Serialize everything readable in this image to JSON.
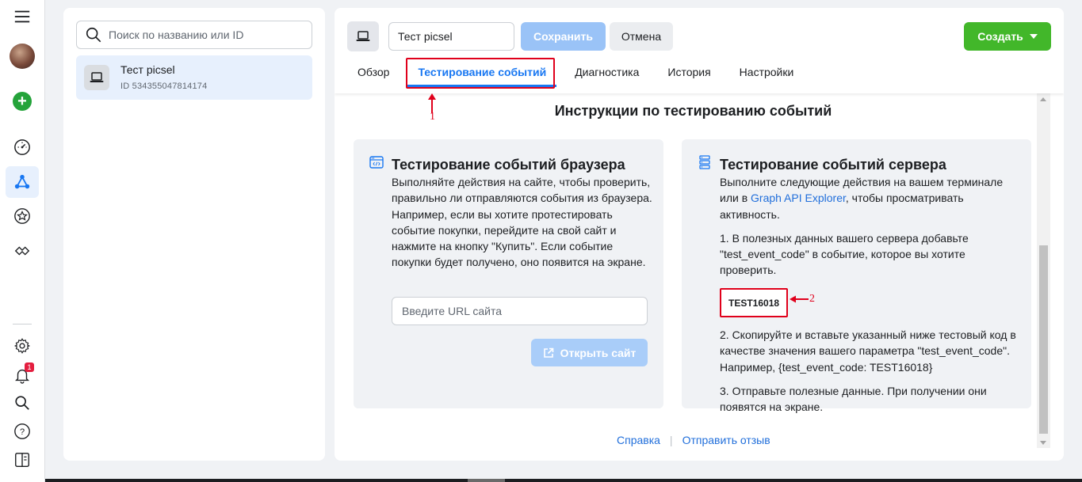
{
  "colors": {
    "accent": "#1877f2",
    "create_green": "#42b72a",
    "save_disabled": "#9ac3f7",
    "annotation_red": "#e0001b",
    "link": "#216fdb"
  },
  "rail": {
    "icons": [
      "hamburger-menu-icon",
      "avatar",
      "add-icon",
      "dashboard-gauge-icon",
      "events-manager-icon",
      "star-icon",
      "partner-handshake-icon",
      "settings-gear-icon",
      "bell-icon",
      "search-icon",
      "help-icon",
      "panel-toggle-icon"
    ],
    "notifications_count": "1"
  },
  "left_panel": {
    "search_placeholder": "Поиск по названию или ID",
    "pixel": {
      "name": "Тест picsel",
      "id_text": "ID 534355047814174"
    }
  },
  "header": {
    "pixel_name_value": "Тест picsel",
    "save_label": "Сохранить",
    "cancel_label": "Отмена",
    "create_label": "Создать",
    "tabs": [
      {
        "label": "Обзор",
        "active": false
      },
      {
        "label": "Тестирование событий",
        "active": true
      },
      {
        "label": "Диагностика",
        "active": false
      },
      {
        "label": "История",
        "active": false
      },
      {
        "label": "Настройки",
        "active": false
      }
    ]
  },
  "annotations": {
    "marker_1": "1",
    "marker_2": "2"
  },
  "main": {
    "section_title": "Инструкции по тестированию событий",
    "browser_card": {
      "title": "Тестирование событий браузера",
      "body": "Выполняйте действия на сайте, чтобы проверить, правильно ли отправляются события из браузера. Например, если вы хотите протестировать событие покупки, перейдите на свой сайт и нажмите на кнопку \"Купить\". Если событие покупки будет получено, оно появится на экране.",
      "url_placeholder": "Введите URL сайта",
      "open_site_label": "Открыть сайт"
    },
    "server_card": {
      "title": "Тестирование событий сервера",
      "intro_before_link": "Выполните следующие действия на вашем терминале или в ",
      "intro_link": "Graph API Explorer",
      "intro_after_link": ", чтобы просматривать активность.",
      "step1": "1. В полезных данных вашего сервера добавьте \"test_event_code\" в событие, которое вы хотите проверить.",
      "test_code": "TEST16018",
      "step2": "2. Скопируйте и вставьте указанный ниже тестовый код в качестве значения вашего параметра \"test_event_code\". Например, {test_event_code: TEST16018}",
      "step3": "3. Отправьте полезные данные. При получении они появятся на экране."
    },
    "footer": {
      "help_label": "Справка",
      "separator": "|",
      "feedback_label": "Отправить отзыв"
    }
  }
}
